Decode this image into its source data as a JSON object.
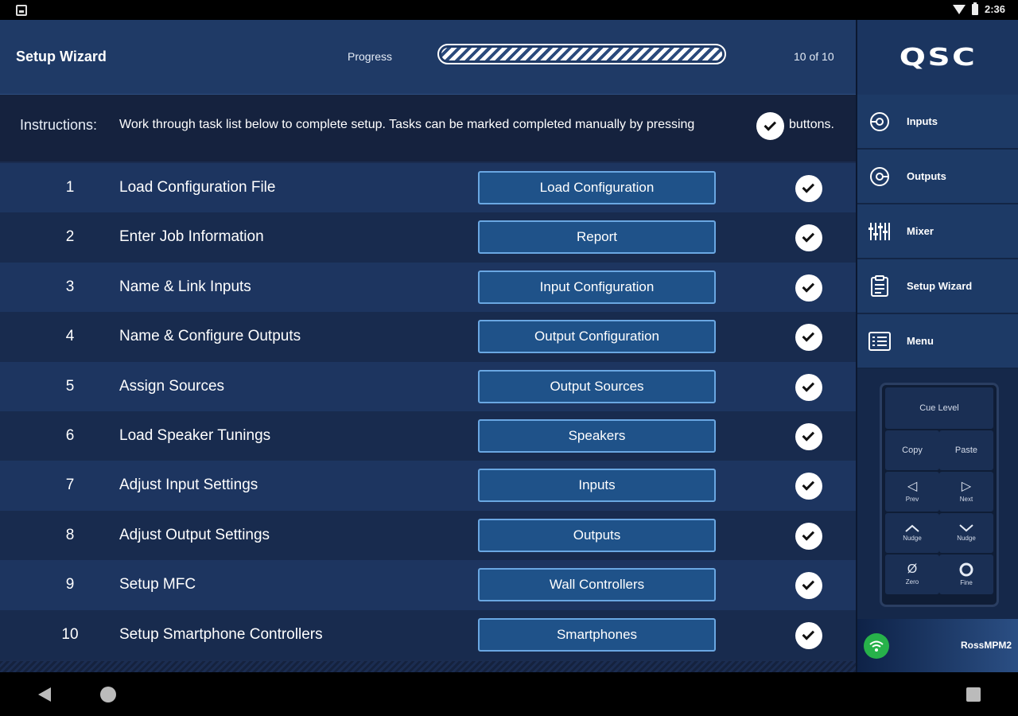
{
  "status_bar": {
    "time": "2:36"
  },
  "header": {
    "title": "Setup Wizard",
    "progress_label": "Progress",
    "progress_fraction": 1.0,
    "progress_count": "10 of 10"
  },
  "instructions": {
    "label": "Instructions:",
    "text": "Work through task list below to complete setup. Tasks can be marked completed manually by pressing",
    "tail": "buttons."
  },
  "tasks": [
    {
      "num": "1",
      "name": "Load Configuration File",
      "button": "Load Configuration",
      "completed": true
    },
    {
      "num": "2",
      "name": "Enter Job Information",
      "button": "Report",
      "completed": true
    },
    {
      "num": "3",
      "name": "Name & Link Inputs",
      "button": "Input Configuration",
      "completed": true
    },
    {
      "num": "4",
      "name": "Name & Configure Outputs",
      "button": "Output Configuration",
      "completed": true
    },
    {
      "num": "5",
      "name": "Assign Sources",
      "button": "Output Sources",
      "completed": true
    },
    {
      "num": "6",
      "name": "Load Speaker Tunings",
      "button": "Speakers",
      "completed": true
    },
    {
      "num": "7",
      "name": "Adjust Input Settings",
      "button": "Inputs",
      "completed": true
    },
    {
      "num": "8",
      "name": "Adjust Output Settings",
      "button": "Outputs",
      "completed": true
    },
    {
      "num": "9",
      "name": "Setup MFC",
      "button": "Wall Controllers",
      "completed": true
    },
    {
      "num": "10",
      "name": "Setup Smartphone Controllers",
      "button": "Smartphones",
      "completed": true
    }
  ],
  "sidebar": {
    "logo": "QSC",
    "nav": [
      {
        "label": "Inputs",
        "icon": "input-icon"
      },
      {
        "label": "Outputs",
        "icon": "output-icon"
      },
      {
        "label": "Mixer",
        "icon": "mixer-faders-icon"
      },
      {
        "label": "Setup Wizard",
        "icon": "clipboard-checklist-icon"
      },
      {
        "label": "Menu",
        "icon": "list-menu-icon"
      }
    ],
    "cue": {
      "level": "Cue Level",
      "copy": "Copy",
      "paste": "Paste",
      "prev": "Prev",
      "next": "Next",
      "nudge_up": "Nudge",
      "nudge_down": "Nudge",
      "zero": "Zero",
      "fine": "Fine"
    },
    "device_name": "RossMPM2"
  },
  "colors": {
    "background": "#1a2c4f",
    "header": "#1f3a66",
    "button_fill": "#1f5289",
    "button_border": "#6aa7e2",
    "wifi_green": "#27b24a"
  }
}
